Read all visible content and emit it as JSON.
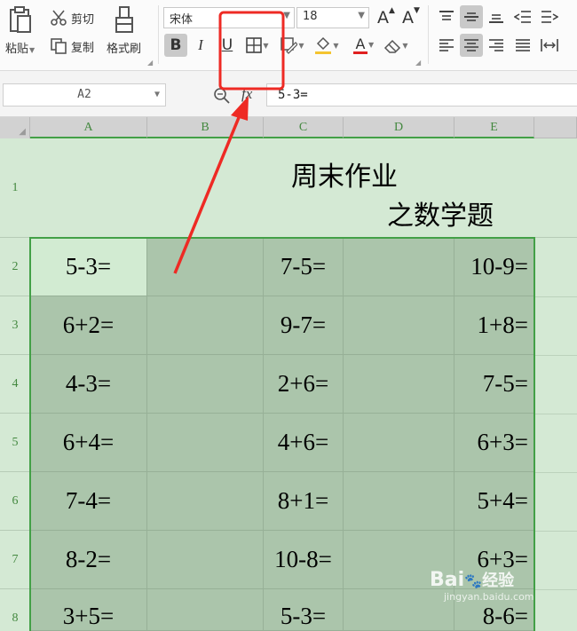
{
  "ribbon": {
    "paste_label": "粘贴",
    "cut_label": "剪切",
    "copy_label": "复制",
    "format_painter_label": "格式刷",
    "font_name": "宋体",
    "font_size": "18",
    "grow_font": "A",
    "shrink_font": "A",
    "bold": "B",
    "italic": "I",
    "underline": "U",
    "font_color_glyph": "A"
  },
  "formula_bar": {
    "name_box": "A2",
    "fx_label": "fx",
    "formula": "5-3="
  },
  "sheet": {
    "columns": [
      "A",
      "B",
      "C",
      "D",
      "E"
    ],
    "rows": [
      "1",
      "2",
      "3",
      "4",
      "5",
      "6",
      "7",
      "8"
    ],
    "title_line1": "周末作业",
    "title_line2": "之数学题",
    "cells": {
      "A": [
        "5-3=",
        "6+2=",
        "4-3=",
        "6+4=",
        "7-4=",
        "8-2=",
        "3+5="
      ],
      "C": [
        "7-5=",
        "9-7=",
        "2+6=",
        "4+6=",
        "8+1=",
        "10-8=",
        "5-3="
      ],
      "E": [
        "10-9=",
        "1+8=",
        "7-5=",
        "6+3=",
        "5+4=",
        "6+3=",
        "8-6="
      ]
    }
  },
  "watermark": {
    "brand": "Bai",
    "brand2": "经验",
    "url": "jingyan.baidu.com"
  },
  "colors": {
    "annotation_red": "#ee2a24",
    "selection_green": "#43a047",
    "cell_selected": "#abc5ab"
  }
}
